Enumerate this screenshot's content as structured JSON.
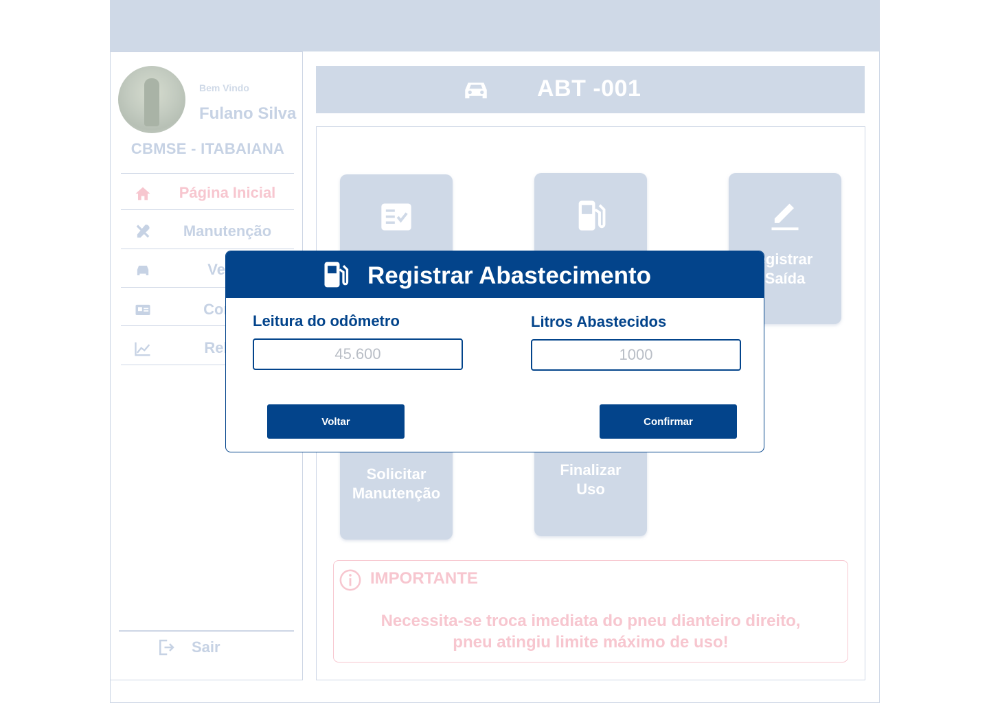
{
  "user": {
    "welcome": "Bem Vindo",
    "name": "Fulano Silva",
    "unit": "CBMSE - ITABAIANA"
  },
  "nav": {
    "items": [
      {
        "label": "Página Inicial",
        "icon": "home-icon",
        "active": true
      },
      {
        "label": "Manutenção",
        "icon": "tools-icon"
      },
      {
        "label": "Veícu",
        "icon": "car-icon"
      },
      {
        "label": "Condu",
        "icon": "id-card-icon"
      },
      {
        "label": "Relato",
        "icon": "chart-icon"
      }
    ],
    "logout": "Sair"
  },
  "vehicle": {
    "plate": "ABT -001",
    "icon": "car-icon"
  },
  "actions": {
    "checklist": {
      "label_line1": "",
      "label_line2": "",
      "icon": "checklist-icon"
    },
    "fuel": {
      "label_line1": "",
      "label_line2": "",
      "icon": "fuel-pump-icon"
    },
    "exit": {
      "label_line1": "egistrar",
      "label_line2": "Saída",
      "icon": "edit-icon"
    },
    "maintenance": {
      "label_line1": "Solicitar",
      "label_line2": "Manutenção"
    },
    "finish": {
      "label_line1": "Finalizar",
      "label_line2": "Uso"
    }
  },
  "notice": {
    "title": "IMPORTANTE",
    "line1": "Necessita-se troca imediata do pneu dianteiro direito,",
    "line2": "pneu atingiu limite máximo de uso!",
    "icon": "info-icon"
  },
  "modal": {
    "title": "Registrar Abastecimento",
    "icon": "fuel-pump-icon",
    "odometer_label": "Leitura do odômetro",
    "odometer_placeholder": "45.600",
    "liters_label": "Litros Abastecidos",
    "liters_placeholder": "1000",
    "back_label": "Voltar",
    "confirm_label": "Confirmar"
  },
  "colors": {
    "primary": "#03448b",
    "faded_blue": "#cfd9e7",
    "faded_pink": "#f7c6cf"
  }
}
